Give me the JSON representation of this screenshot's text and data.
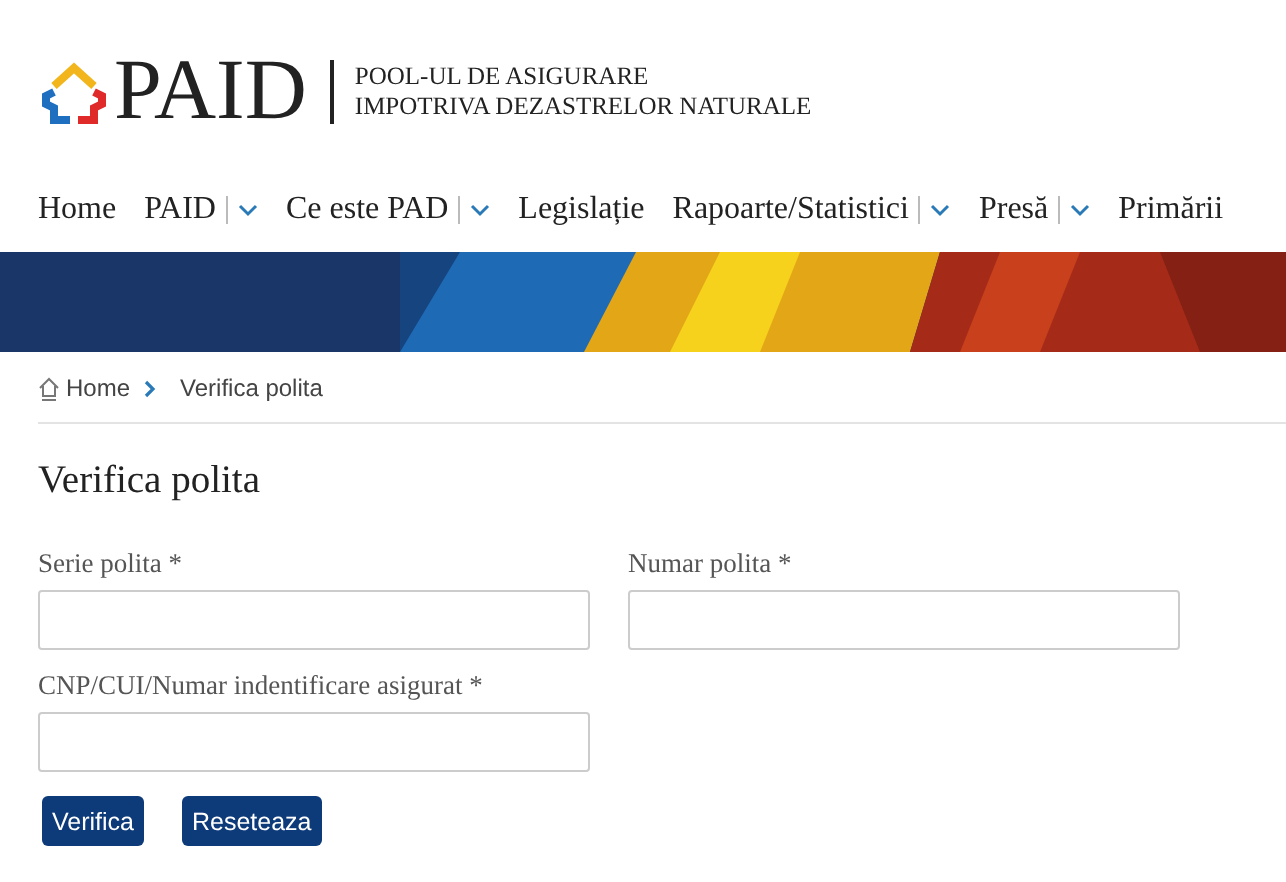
{
  "logo": {
    "name": "PAID",
    "tagline": [
      "POOL-UL DE ASIGURARE",
      "IMPOTRIVA DEZASTRELOR NATURALE"
    ]
  },
  "nav": [
    {
      "label": "Home",
      "dropdown": false
    },
    {
      "label": "PAID",
      "dropdown": true
    },
    {
      "label": "Ce este PAD",
      "dropdown": true
    },
    {
      "label": "Legislație",
      "dropdown": false
    },
    {
      "label": "Rapoarte/Statistici",
      "dropdown": true
    },
    {
      "label": "Presă",
      "dropdown": true
    },
    {
      "label": "Primării",
      "dropdown": false
    }
  ],
  "banner": {
    "kind": "picture"
  },
  "breadcrumb": [
    {
      "label": "Home",
      "kind": "home"
    },
    {
      "label": "Verifica polita",
      "kind": "current"
    }
  ],
  "title": "Verifica polita",
  "fields": [
    {
      "label": "Serie polita *"
    },
    {
      "label": "Numar polita *"
    },
    {
      "label": "CNP/CUI/Numar indentificare asigurat *"
    }
  ],
  "buttons": [
    "Verifica",
    "Reseteaza"
  ]
}
